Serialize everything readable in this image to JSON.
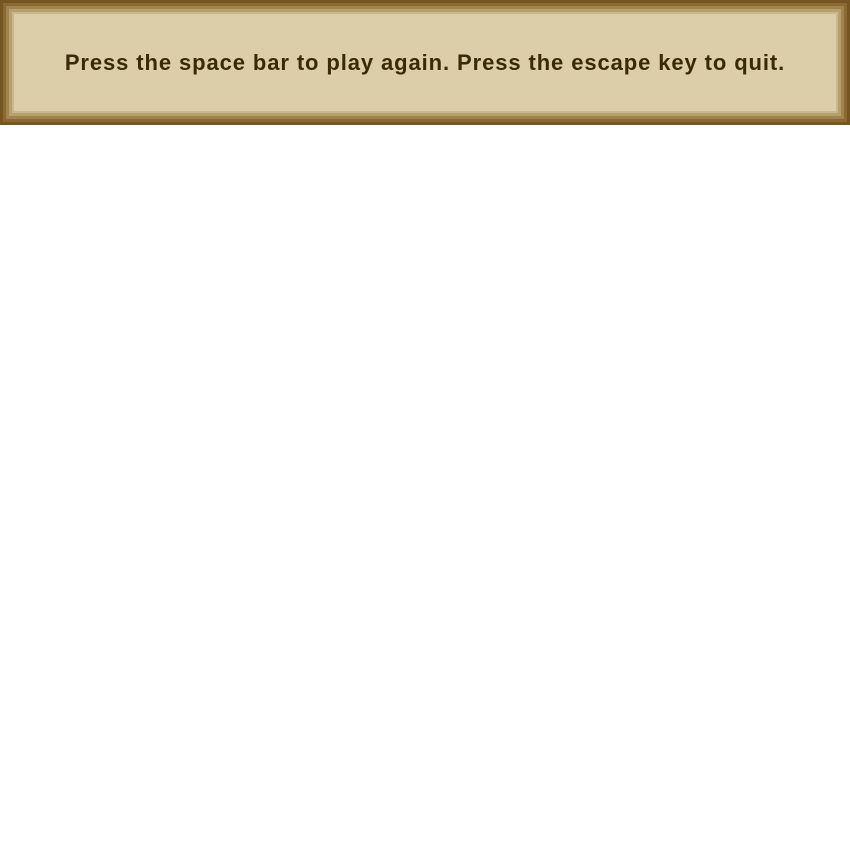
{
  "message_banner": {
    "text": "Press the space bar to play again. Press the escape key to quit."
  },
  "colors": {
    "banner_frame": "#775522",
    "banner_fill": "#dccea8",
    "banner_text": "#3a2a08",
    "background": "#ffffff"
  }
}
